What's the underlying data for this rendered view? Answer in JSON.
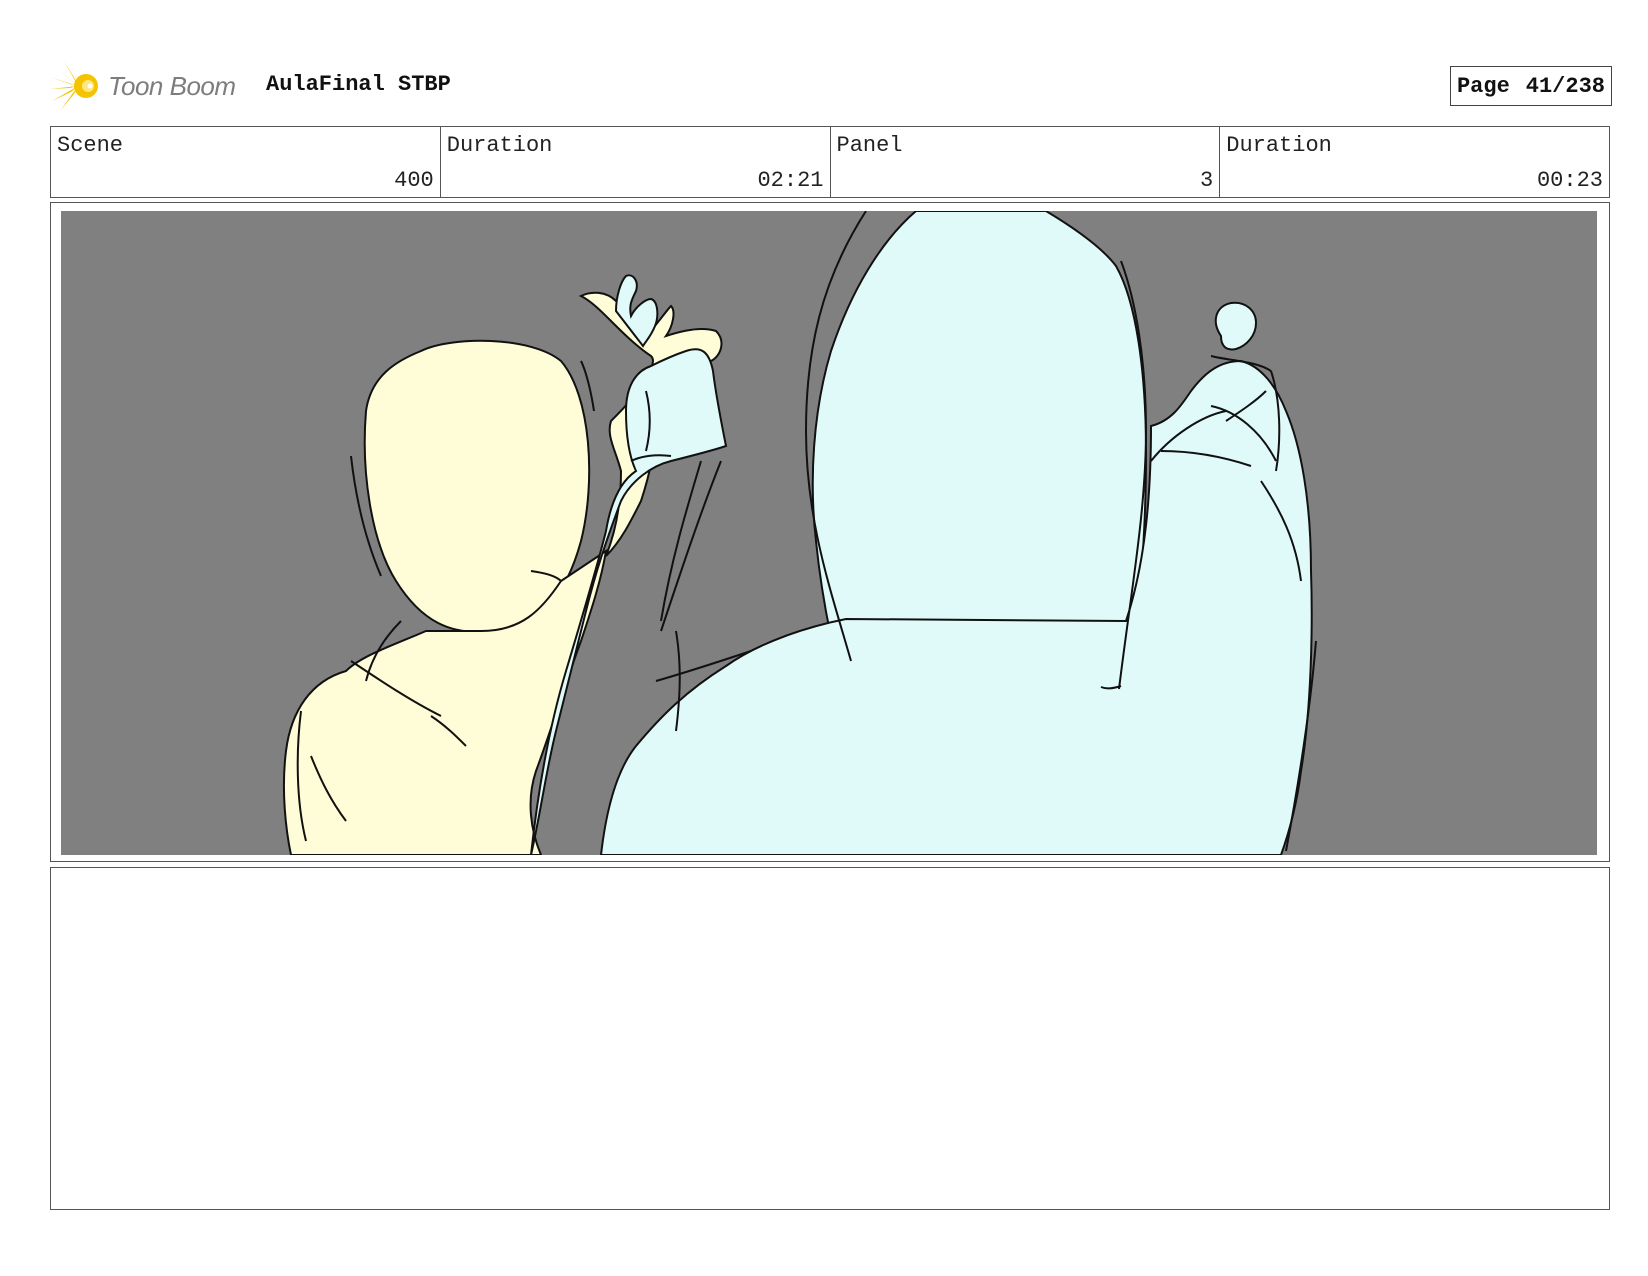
{
  "header": {
    "logo_text": "Toon Boom",
    "project_title": "AulaFinal STBP",
    "page_label": "Page",
    "page_number": "41/238"
  },
  "info": {
    "scene_label": "Scene",
    "scene_value": "400",
    "scene_duration_label": "Duration",
    "scene_duration_value": "02:21",
    "panel_label": "Panel",
    "panel_value": "3",
    "panel_duration_label": "Duration",
    "panel_duration_value": "00:23"
  },
  "colors": {
    "background": "#808080",
    "figure_left": "#fffdd7",
    "figure_right": "#e0fafa",
    "logo_yellow": "#f5c400",
    "line": "#111111"
  },
  "icons": {
    "logo": "toon-boom-starburst-icon"
  }
}
